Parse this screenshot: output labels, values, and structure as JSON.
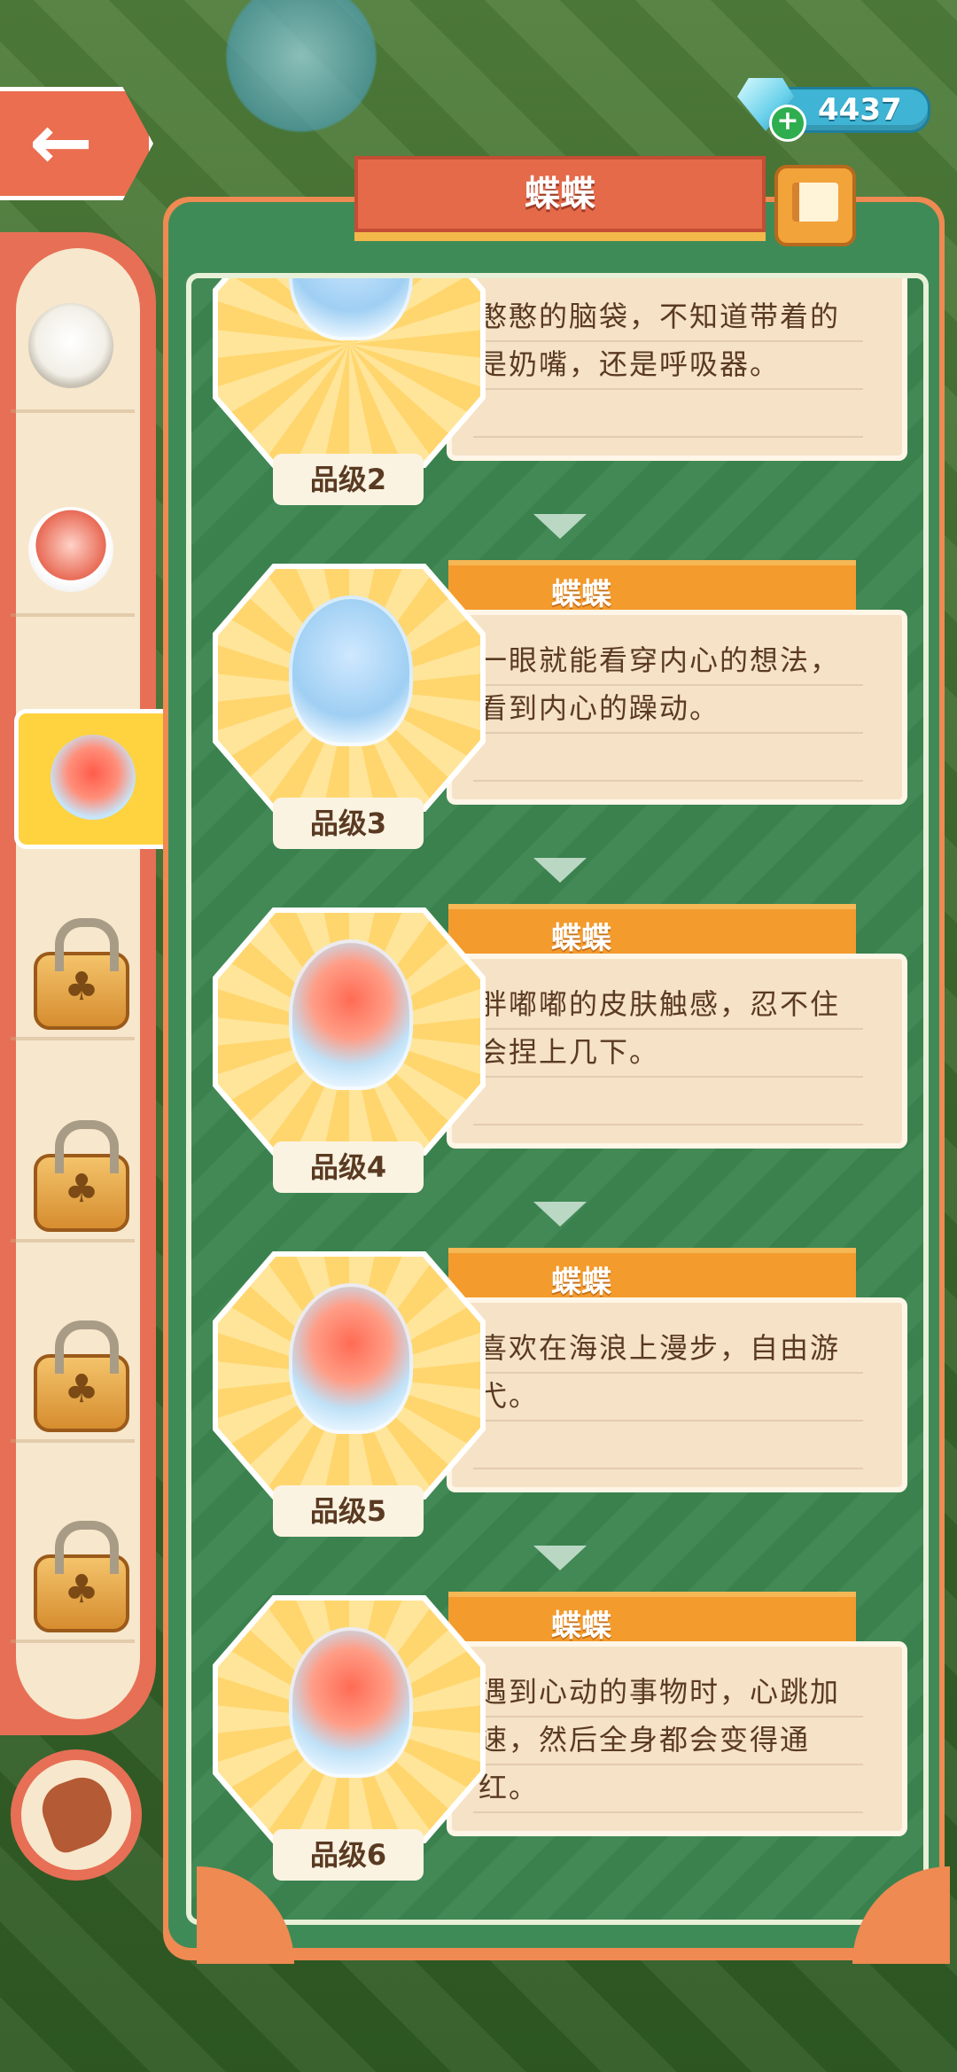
{
  "currency": {
    "gems": "4437"
  },
  "header": {
    "title": "蝶蝶"
  },
  "cards": [
    {
      "name": "",
      "desc": "憨憨的脑袋，不知道带着的是奶嘴，还是呼吸器。",
      "grade": "品级2",
      "partial": true
    },
    {
      "name": "蝶蝶",
      "desc": "一眼就能看穿内心的想法，看到内心的躁动。",
      "grade": "品级3"
    },
    {
      "name": "蝶蝶",
      "desc": "胖嘟嘟的皮肤触感，忍不住会捏上几下。",
      "grade": "品级4"
    },
    {
      "name": "蝶蝶",
      "desc": "喜欢在海浪上漫步，自由游弋。",
      "grade": "品级5"
    },
    {
      "name": "蝶蝶",
      "desc": "遇到心动的事物时，心跳加速，然后全身都会变得通红。",
      "grade": "品级6"
    }
  ],
  "sidebar": {
    "items": [
      {
        "kind": "pet",
        "icon": "sheep-pet-icon"
      },
      {
        "kind": "pet",
        "icon": "pig-pet-icon"
      },
      {
        "kind": "pet",
        "icon": "jelly-cat-pet-icon",
        "selected": true
      },
      {
        "kind": "locked",
        "icon": "padlock-icon"
      },
      {
        "kind": "locked",
        "icon": "padlock-icon"
      },
      {
        "kind": "locked",
        "icon": "padlock-icon"
      },
      {
        "kind": "locked",
        "icon": "padlock-icon"
      }
    ]
  },
  "colors": {
    "panel_green": "#3f8b57",
    "panel_orange": "#ee8a52",
    "tag_orange": "#f39b2d",
    "card_bg": "#f6e2c6",
    "title_red": "#e46a4a"
  }
}
